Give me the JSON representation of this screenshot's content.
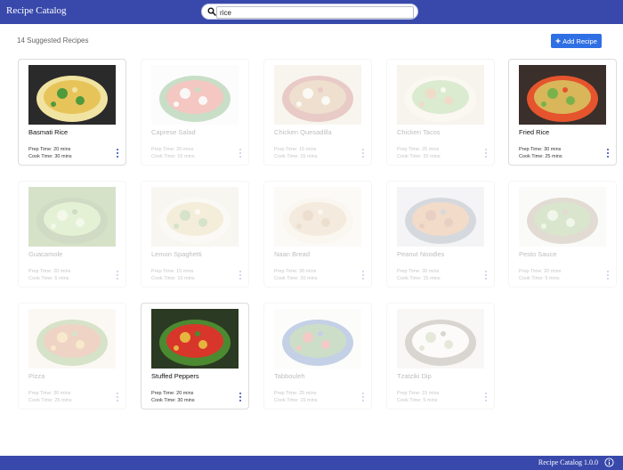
{
  "header": {
    "title": "Recipe Catalog",
    "search_value": "rice"
  },
  "main": {
    "count_label": "14 Suggested Recipes",
    "add_button_label": "Add Recipe",
    "recipes": [
      {
        "name": "Basmati Rice",
        "prep": "Prep Time: 20 mins",
        "cook": "Cook Time: 30 mins",
        "highlighted": true
      },
      {
        "name": "Caprese Salad",
        "prep": "Prep Time: 20 mins",
        "cook": "Cook Time: 15 mins",
        "highlighted": false
      },
      {
        "name": "Chicken Quesadilla",
        "prep": "Prep Time: 15 mins",
        "cook": "Cook Time: 15 mins",
        "highlighted": false
      },
      {
        "name": "Chicken Tacos",
        "prep": "Prep Time: 25 mins",
        "cook": "Cook Time: 20 mins",
        "highlighted": false
      },
      {
        "name": "Fried Rice",
        "prep": "Prep Time: 30 mins",
        "cook": "Cook Time: 25 mins",
        "highlighted": true
      },
      {
        "name": "Guacamole",
        "prep": "Prep Time: 20 mins",
        "cook": "Cook Time: 5 mins",
        "highlighted": false
      },
      {
        "name": "Lemon Spaghetti",
        "prep": "Prep Time: 15 mins",
        "cook": "Cook Time: 15 mins",
        "highlighted": false
      },
      {
        "name": "Naan Bread",
        "prep": "Prep Time: 30 mins",
        "cook": "Cook Time: 20 mins",
        "highlighted": false
      },
      {
        "name": "Peanut Noodles",
        "prep": "Prep Time: 30 mins",
        "cook": "Cook Time: 15 mins",
        "highlighted": false
      },
      {
        "name": "Pesto Sauce",
        "prep": "Prep Time: 20 mins",
        "cook": "Cook Time: 5 mins",
        "highlighted": false
      },
      {
        "name": "Pizza",
        "prep": "Prep Time: 30 mins",
        "cook": "Cook Time: 25 mins",
        "highlighted": false
      },
      {
        "name": "Stuffed Peppers",
        "prep": "Prep Time: 20 mins",
        "cook": "Cook Time: 30 mins",
        "highlighted": true
      },
      {
        "name": "Tabbouleh",
        "prep": "Prep Time: 25 mins",
        "cook": "Cook Time: 15 mins",
        "highlighted": false
      },
      {
        "name": "Tzatziki Dip",
        "prep": "Prep Time: 15 mins",
        "cook": "Cook Time: 5 mins",
        "highlighted": false
      }
    ]
  },
  "footer": {
    "label": "Recipe Catalog 1.0.0"
  },
  "colors": {
    "brand": "#3949ab",
    "button": "#2f6fe4"
  },
  "icons": {
    "search": "search-icon",
    "add": "plus-icon",
    "menu": "more-vert-icon",
    "info": "info-icon"
  }
}
